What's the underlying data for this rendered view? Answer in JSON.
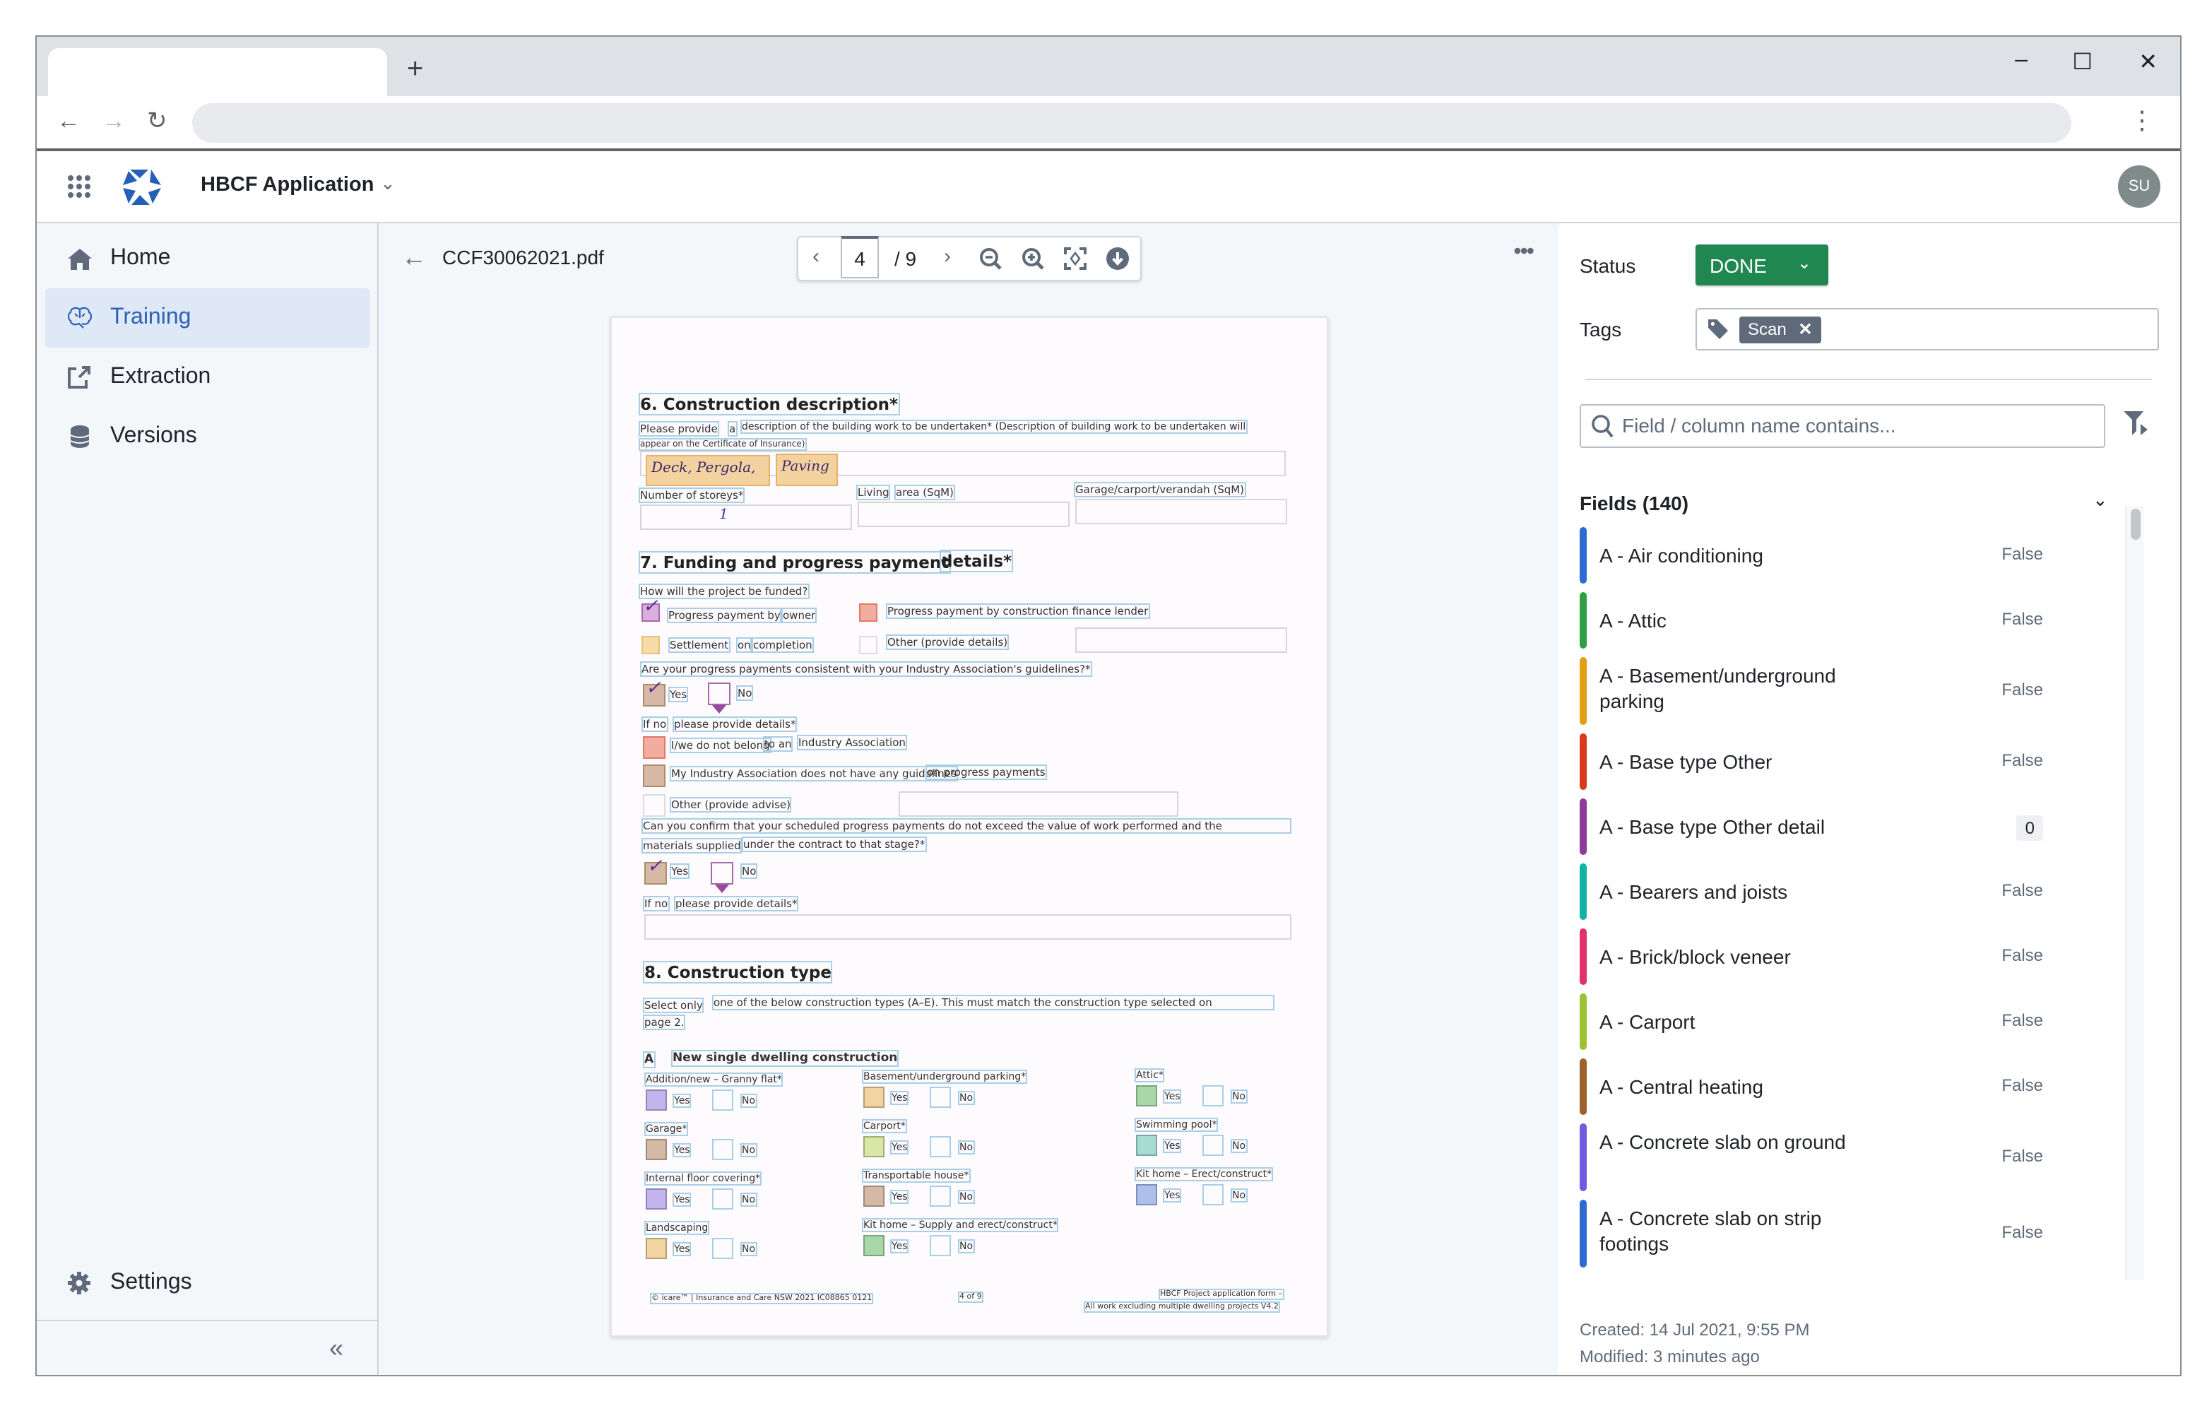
{
  "browser": {
    "new_tab": "+",
    "controls": {
      "minimize": "–",
      "maximize": "☐",
      "close": "✕"
    },
    "nav": {
      "back": "←",
      "forward": "→",
      "reload": "↻",
      "menu": "⋮"
    }
  },
  "header": {
    "app_title": "HBCF Application",
    "avatar_initials": "SU",
    "brand_color": "#2560b8"
  },
  "sidebar": {
    "items": [
      {
        "label": "Home",
        "icon": "home-icon",
        "active": false
      },
      {
        "label": "Training",
        "icon": "brain-icon",
        "active": true
      },
      {
        "label": "Extraction",
        "icon": "external-link-icon",
        "active": false
      },
      {
        "label": "Versions",
        "icon": "database-icon",
        "active": false
      }
    ],
    "settings_label": "Settings",
    "collapse_glyph": "«"
  },
  "viewer": {
    "filename": "CCF30062021.pdf",
    "current_page": "4",
    "total_pages": "/ 9",
    "toolbar_icons": [
      "chevron-left-icon",
      "chevron-right-icon",
      "zoom-out-icon",
      "zoom-in-icon",
      "fit-screen-icon",
      "download-icon"
    ],
    "more_glyph": "•••"
  },
  "document": {
    "s6": {
      "heading": "6. Construction description*",
      "prompt_a": "Please provide",
      "prompt_b": "a",
      "prompt_c": "description of the building work to be undertaken* (Description of building work to be undertaken will",
      "prompt_d": "appear on the Certificate of Insurance)",
      "hw1": "Deck, Pergola,",
      "hw2": "Paving",
      "storeys_label": "Number of storeys*",
      "storeys_value": "1",
      "living_a": "Living",
      "living_b": "area (SqM)",
      "garage_label": "Garage/carport/verandah (SqM)"
    },
    "s7": {
      "heading_a": "7. Funding and progress payment",
      "heading_b": "details*",
      "q1": "How will the project be funded?",
      "opt_owner_a": "Progress payment by",
      "opt_owner_b": "owner",
      "opt_lender": "Progress payment by construction finance lender",
      "opt_settle_a": "Settlement",
      "opt_settle_b": "on",
      "opt_settle_c": "completion",
      "opt_other": "Other (provide details)",
      "q2": "Are your progress payments consistent with your Industry Association's guidelines?*",
      "yes": "Yes",
      "no": "No",
      "ifno": "If no",
      "ifno_b": "please provide details*",
      "opt_nobelong_a": "I/we do not belong",
      "opt_nobelong_b": "to an",
      "opt_nobelong_c": "Industry Association",
      "opt_noguide_a": "My Industry Association does not have any guidelines",
      "opt_noguide_b": "on progress payments",
      "opt_advise": "Other (provide advise)",
      "q3_a": "Can you confirm that your scheduled progress payments do not exceed the value of work performed and the",
      "q3_b": "materials supplied",
      "q3_c": "under the contract to that stage?*"
    },
    "s8": {
      "heading": "8. Construction type",
      "intro_a": "Select only",
      "intro_b": "one of the below construction types (A–E). This must match the construction type selected on",
      "intro_c": "page 2.",
      "sub_a": "A",
      "sub_b": "New single dwelling construction",
      "items": [
        {
          "label": "Addition/new – Granny flat*",
          "color": "#c4b4ee"
        },
        {
          "label": "Garage*",
          "color": "#d4b9a4"
        },
        {
          "label": "Internal floor covering*",
          "color": "#c4b4ee"
        },
        {
          "label": "Landscaping",
          "color": "#f1d4a0"
        },
        {
          "label": "Basement/underground parking*",
          "color": "#f1d4a0"
        },
        {
          "label": "Carport*",
          "color": "#d9e6a6"
        },
        {
          "label": "Transportable house*",
          "color": "#d4b9a4"
        },
        {
          "label": "Kit home – Supply and erect/construct*",
          "color": "#a8d8a8"
        },
        {
          "label": "Attic*",
          "color": "#a8d8a8"
        },
        {
          "label": "Swimming pool*",
          "color": "#a6dcd2"
        },
        {
          "label": "Kit home – Erect/construct*",
          "color": "#aebfec"
        }
      ]
    },
    "footer": {
      "copyright": "© icare™ | Insurance and Care NSW 2021   IC08865 0121",
      "page": "4 of 9",
      "form_a": "HBCF Project application form –",
      "form_b": "All work excluding multiple dwelling projects   V4.2"
    }
  },
  "panel": {
    "status_label": "Status",
    "status_value": "DONE",
    "status_color": "#218751",
    "tags_label": "Tags",
    "tags": [
      "Scan"
    ],
    "tag_remove": "✕",
    "search_placeholder": "Field / column name contains...",
    "fields_heading": "Fields (140)",
    "fields": [
      {
        "name": "A - Air conditioning",
        "value": "False",
        "color": "#2f6ad1"
      },
      {
        "name": "A - Attic",
        "value": "False",
        "color": "#2ea043"
      },
      {
        "name": "A - Basement/underground parking",
        "value": "False",
        "color": "#e0a010"
      },
      {
        "name": "A - Base type Other",
        "value": "False",
        "color": "#d93a1b"
      },
      {
        "name": "A - Base type Other detail",
        "value": "0",
        "color": "#8e3a9d"
      },
      {
        "name": "A - Bearers and joists",
        "value": "False",
        "color": "#13b3a3"
      },
      {
        "name": "A - Brick/block veneer",
        "value": "False",
        "color": "#e0306e"
      },
      {
        "name": "A - Carport",
        "value": "False",
        "color": "#9cc234"
      },
      {
        "name": "A - Central heating",
        "value": "False",
        "color": "#a0622d"
      },
      {
        "name": "A - Concrete slab on ground",
        "value": "False",
        "color": "#6f5ce0"
      },
      {
        "name": "A - Concrete slab on strip footings",
        "value": "False",
        "color": "#2f6ad1"
      }
    ],
    "created": "Created: 14 Jul 2021, 9:55 PM",
    "modified": "Modified: 3 minutes ago"
  }
}
